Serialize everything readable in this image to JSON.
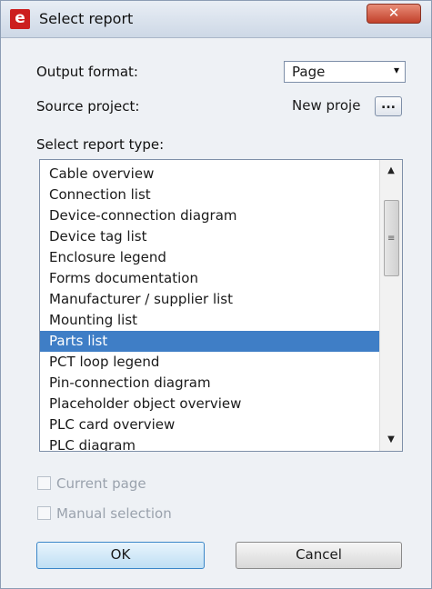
{
  "window": {
    "title": "Select report",
    "app_icon_letter": "e",
    "close_glyph": "✕"
  },
  "output_format": {
    "label": "Output format:",
    "value": "Page"
  },
  "source_project": {
    "label": "Source project:",
    "value": "New proje",
    "browse_label": "..."
  },
  "report_type": {
    "label": "Select report type:",
    "items": [
      "Cable overview",
      "Connection list",
      "Device-connection diagram",
      "Device tag list",
      "Enclosure legend",
      "Forms documentation",
      "Manufacturer / supplier list",
      "Mounting list",
      "Parts list",
      "PCT loop legend",
      "Pin-connection diagram",
      "Placeholder object overview",
      "PLC card overview",
      "PLC diagram"
    ],
    "selected": "Parts list"
  },
  "options": {
    "current_page": "Current page",
    "manual_selection": "Manual selection"
  },
  "buttons": {
    "ok": "OK",
    "cancel": "Cancel"
  },
  "colors": {
    "selection": "#3f7ec6",
    "app_icon": "#cc1f1f",
    "close": "#c2402a"
  }
}
